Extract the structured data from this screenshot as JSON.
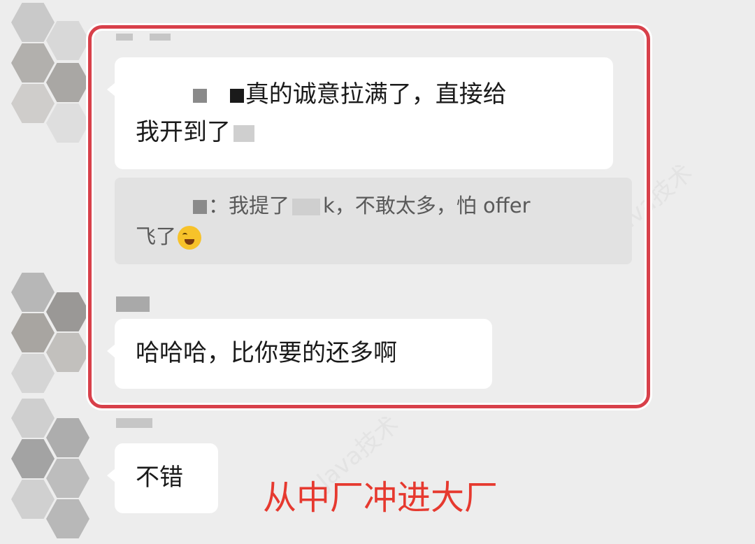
{
  "chat": {
    "messages": [
      {
        "text_main": "真的诚意拉满了，直接给",
        "text_line2": "我开到了"
      },
      {
        "quote_prefix": "：我提了",
        "quote_mid": "k，不敢太多，怕 offer",
        "quote_line2": "飞了"
      },
      {
        "text": "哈哈哈，比你要的还多啊"
      },
      {
        "text": "不错"
      }
    ]
  },
  "caption": "从中厂冲进大厂",
  "colors": {
    "highlight": "#d8404a",
    "caption": "#e6392f",
    "background": "#ededed",
    "bubble": "#ffffff"
  },
  "icons": {
    "emoji": "laughing-crying-emoji-icon"
  }
}
